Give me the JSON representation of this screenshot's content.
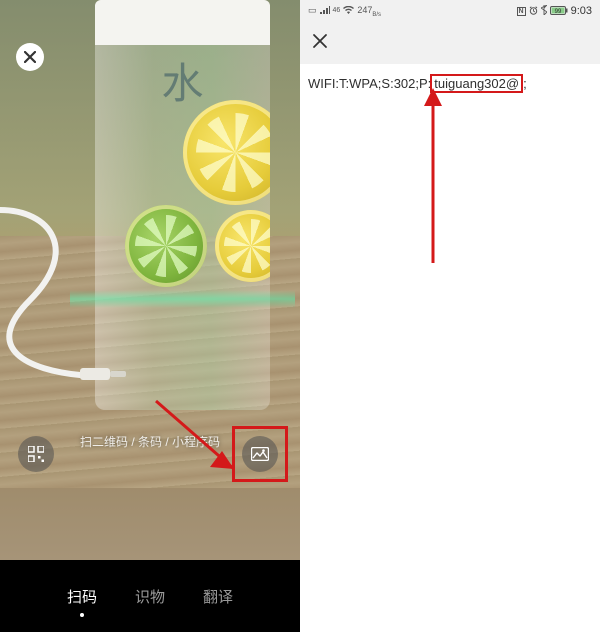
{
  "left": {
    "bottleChar": "水",
    "hint": "扫二维码 / 条码 / 小程序码",
    "tabs": {
      "scan": "扫码",
      "detect": "识物",
      "translate": "翻译"
    },
    "icons": {
      "close": "close-icon",
      "myqr": "qr-grid-icon",
      "gallery": "image-icon"
    }
  },
  "right": {
    "status": {
      "net": "247",
      "netUnit": "B/s",
      "nfc": "N",
      "battery": "99",
      "time": "9:03"
    },
    "wifiPrefix": "WIFI:T:WPA;S:302;P:",
    "wifiHighlighted": "tuiguang302@",
    "wifiSuffix": ";"
  },
  "annotations": {
    "colorRed": "#d4191a"
  }
}
